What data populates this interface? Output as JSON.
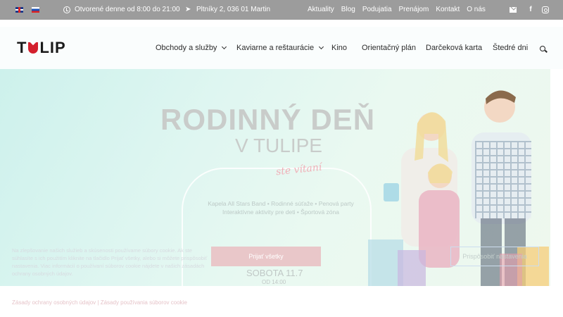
{
  "topbar": {
    "hours": "Otvorené denne od 8:00 do 21:00",
    "address": "Pltníky 2, 036 01 Martin",
    "links": [
      "Aktuality",
      "Blog",
      "Podujatia",
      "Prenájom",
      "Kontakt",
      "O nás"
    ],
    "languages": [
      "en-flag-icon",
      "sk-flag-icon"
    ],
    "social_icons": [
      "mail-icon",
      "facebook-icon",
      "instagram-icon"
    ],
    "bg_color": "#9c9c9c"
  },
  "header": {
    "logo_text": {
      "t": "T",
      "rest": "LIP"
    },
    "nav": [
      {
        "label": "Obchody a služby",
        "dropdown": true
      },
      {
        "label": "Kaviarne a reštaurácie",
        "dropdown": true
      },
      {
        "label": "Kino",
        "dropdown": false
      },
      {
        "label": "Orientačný plán",
        "dropdown": false
      },
      {
        "label": "Darčeková karta",
        "dropdown": false
      },
      {
        "label": "Štedré dni",
        "dropdown": false
      }
    ],
    "brand_color": "#d3202d"
  },
  "hero": {
    "title": "RODINNÝ DEŇ",
    "subtitle": "V TULIPE",
    "script": "ste vítaní",
    "lines": [
      "Kapela All Stars Band • Rodinné súťaže • Penová party",
      "Interaktívne aktivity pre deti • Športová zóna"
    ],
    "cta_primary": "Prijať všetky",
    "cta_secondary": "Prispôsobiť nastavenia",
    "date": "SOBOTA 11.7",
    "time": "OD 14:00"
  },
  "cookie": {
    "text": "Na zlepšovanie našich služieb a skúsenosti používame súbory cookie. Ak ste súhlasíte s ich použitím kliknite na tlačidlo Prijať všetky, alebo si môžete prispôsobiť nastavenia. Viac informácií o používaní súborov cookie nájdete v našich zásadách ochrany osobných údajov.",
    "links": "Zásady ochrany osobných údajov  |  Zásady používania súborov cookie"
  }
}
